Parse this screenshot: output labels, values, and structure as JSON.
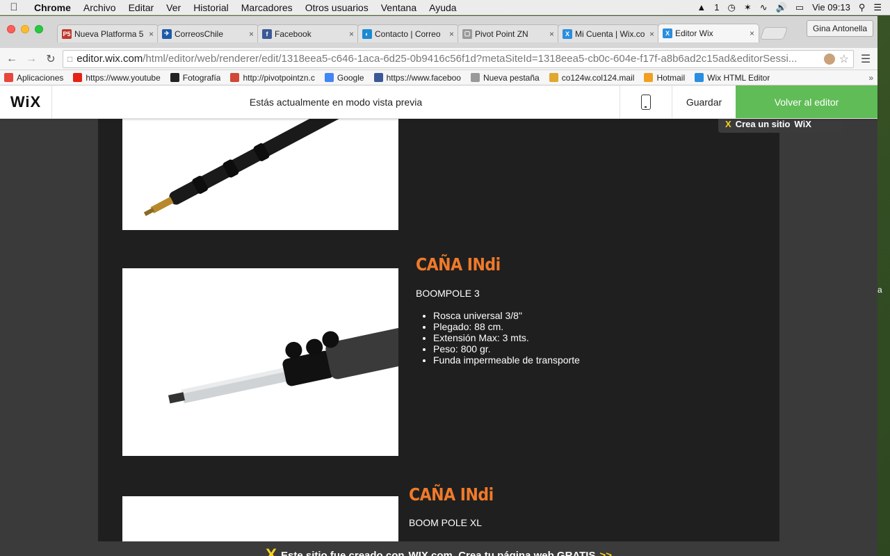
{
  "menubar": {
    "app": "Chrome",
    "items": [
      "Archivo",
      "Editar",
      "Ver",
      "Historial",
      "Marcadores",
      "Otros usuarios",
      "Ventana",
      "Ayuda"
    ],
    "status": {
      "input_indicator": "1",
      "clock": "Vie 09:13"
    }
  },
  "browser": {
    "tabs": [
      {
        "title": "Nueva Platforma 5",
        "fav": "P5",
        "color": "#c0392b"
      },
      {
        "title": "CorreosChile",
        "fav": "✈",
        "color": "#1e5aa8"
      },
      {
        "title": "Facebook",
        "fav": "f",
        "color": "#3b5998"
      },
      {
        "title": "Contacto | Correo",
        "fav": "◐",
        "color": "#1b8ad3"
      },
      {
        "title": "Pivot Point ZN",
        "fav": "▢",
        "color": "#999999"
      },
      {
        "title": "Mi Cuenta | Wix.co",
        "fav": "X",
        "color": "#2a8ee0"
      },
      {
        "title": "Editor Wix",
        "fav": "X",
        "color": "#2a8ee0"
      }
    ],
    "profile": "Gina Antonella",
    "address": {
      "host": "editor.wix.com",
      "path": "/html/editor/web/renderer/edit/1318eea5-c646-1aca-6d25-0b9416c56f1d?metaSiteId=1318eea5-cb0c-604e-f17f-a8b6ad2c15ad&editorSessi..."
    },
    "bookmarks": [
      {
        "label": "Aplicaciones",
        "icon": "apps-icon",
        "color": "#e8453c"
      },
      {
        "label": "https://www.youtube",
        "icon": "youtube-icon",
        "color": "#e62117"
      },
      {
        "label": "Fotografía",
        "icon": "photo-icon",
        "color": "#222222"
      },
      {
        "label": "http://pivotpointzn.c",
        "icon": "gmail-icon",
        "color": "#d14836"
      },
      {
        "label": "Google",
        "icon": "google-icon",
        "color": "#4285f4"
      },
      {
        "label": "https://www.faceboo",
        "icon": "facebook-icon",
        "color": "#3b5998"
      },
      {
        "label": "Nueva pestaña",
        "icon": "page-icon",
        "color": "#999999"
      },
      {
        "label": "co124w.col124.mail",
        "icon": "mail-icon",
        "color": "#e0a82e"
      },
      {
        "label": "Hotmail",
        "icon": "hotmail-icon",
        "color": "#f0a020"
      },
      {
        "label": "Wix HTML Editor",
        "icon": "wix-icon",
        "color": "#2a8ee0"
      }
    ],
    "bookmarks_more": "»"
  },
  "wix_bar": {
    "logo": "WiX",
    "message": "Estás actualmente en modo vista previa",
    "save": "Guardar",
    "back": "Volver al editor"
  },
  "site": {
    "badge": {
      "prefix": "Crea un sitio",
      "brand": "WiX"
    },
    "products": [
      {
        "title": "CAÑA INdi",
        "subtitle": "BOOMPOLE 3",
        "features": [
          "Rosca universal 3/8\"",
          "Plegado: 88 cm.",
          "Extensión Max: 3 mts.",
          "Peso: 800 gr.",
          "Funda impermeable de transporte"
        ]
      },
      {
        "title": "CAÑA INdi",
        "subtitle": "BOOM POLE XL"
      }
    ],
    "promo": {
      "text": "Este sitio fue creado con",
      "brand": "WIX.com",
      "cta": ". Crea tu página web GRATIS",
      "arrow": ">>"
    },
    "side_fragment": "a"
  },
  "colors": {
    "accent_orange": "#f07a2a",
    "wix_green": "#60bc57",
    "wix_yellow": "#f9d41c"
  }
}
